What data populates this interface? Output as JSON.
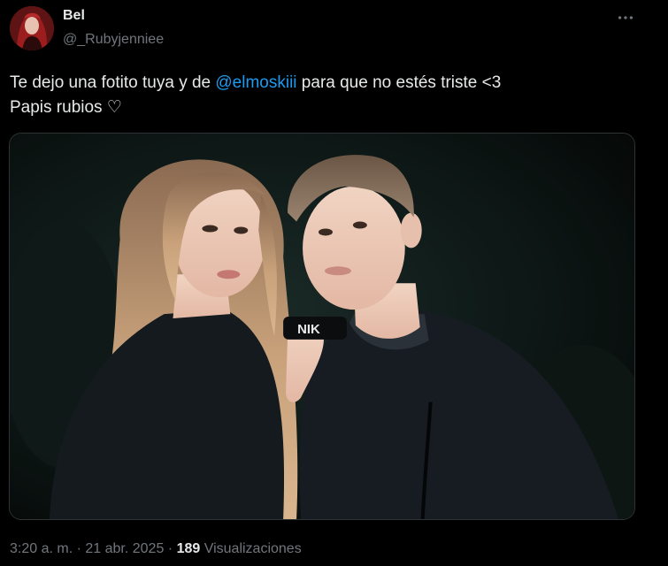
{
  "author": {
    "display_name": "Bel",
    "handle": "@_Rubyjenniee"
  },
  "tweet": {
    "text_before_mention": "Te dejo una fotito tuya y de ",
    "mention": "@elmoskiii",
    "text_after_mention": " para que no estés triste <3",
    "second_line": "Papis rubios ♡"
  },
  "meta": {
    "time": "3:20 a. m.",
    "separator": " · ",
    "date": "21 abr. 2025",
    "separator2": " · ",
    "views_count": "189",
    "views_label": " Visualizaciones"
  },
  "photo": {
    "shirt_text": "NIK"
  },
  "icons": {
    "more": "more-horizontal-icon"
  },
  "colors": {
    "background": "#000000",
    "text": "#e7e9ea",
    "secondary": "#71767b",
    "accent": "#1d9bf0"
  }
}
